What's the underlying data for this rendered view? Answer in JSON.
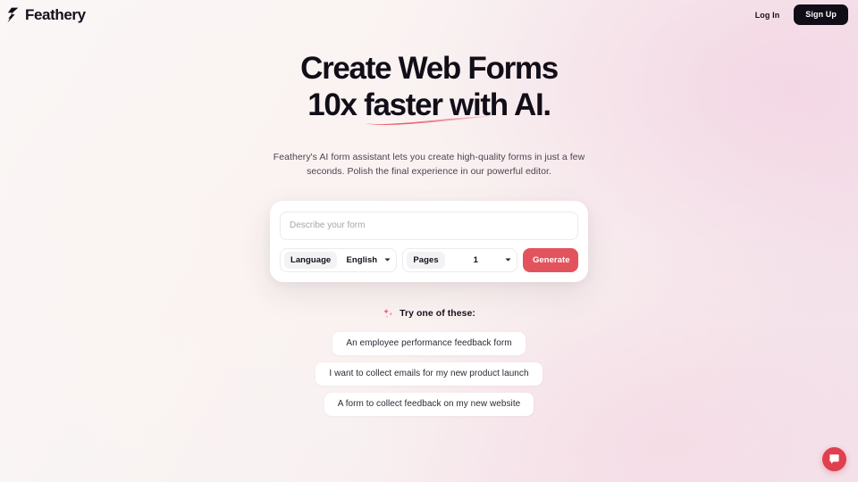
{
  "nav": {
    "brand_name": "Feathery",
    "brand_mark_icon": "feather-logo-icon",
    "login_label": "Log In",
    "signup_label": "Sign Up"
  },
  "hero": {
    "headline_line1": "Create Web Forms",
    "headline_line2": "10x faster with AI.",
    "underline_icon": "underline-swoosh-icon",
    "subtitle": "Feathery's AI form assistant lets you create high-quality forms in just a few seconds. Polish the final experience in our powerful editor."
  },
  "generator": {
    "describe_placeholder": "Describe your form",
    "describe_value": "",
    "language": {
      "label": "Language",
      "value": "English",
      "caret_icon": "chevron-down-icon"
    },
    "pages": {
      "label": "Pages",
      "value": "1",
      "caret_icon": "chevron-down-icon"
    },
    "generate_label": "Generate",
    "generate_color": "#e2535e"
  },
  "suggestions": {
    "sparkle_icon": "sparkles-icon",
    "heading": "Try one of these:",
    "chips": [
      "An employee performance feedback form",
      "I want to collect emails for my new product launch",
      "A form to collect feedback on my new website"
    ]
  },
  "chat": {
    "launcher_icon": "chat-bubble-icon",
    "launcher_color": "#e0404e"
  }
}
